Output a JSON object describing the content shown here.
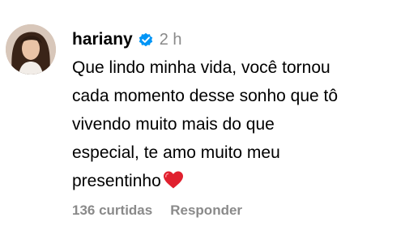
{
  "comment": {
    "username": "hariany",
    "verified_icon": "verified-badge-icon",
    "time": "2 h",
    "text_lines": [
      "Que lindo minha vida, você tornou",
      "cada momento desse sonho que tô",
      "vivendo muito mais do que",
      "especial, te amo muito meu",
      "presentinho"
    ],
    "heart_icon": "red-heart-emoji",
    "likes": "136 curtidas",
    "reply_label": "Responder"
  },
  "colors": {
    "text": "#000000",
    "secondary": "#8a8a8a",
    "verified": "#0095f6",
    "heart": "#e0202e"
  }
}
